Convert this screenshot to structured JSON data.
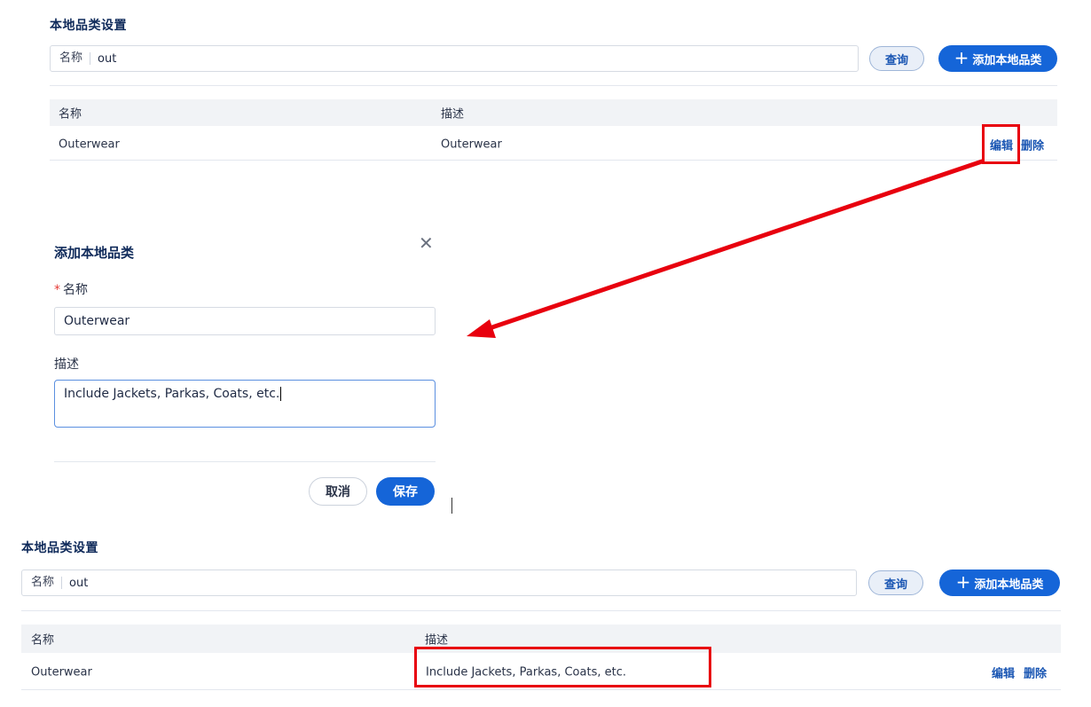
{
  "before": {
    "title": "本地品类设置",
    "search": {
      "label": "名称",
      "value": "out"
    },
    "query_label": "查询",
    "add_label": "添加本地品类",
    "table": {
      "headers": [
        "名称",
        "描述"
      ],
      "rows": [
        {
          "name": "Outerwear",
          "description": "Outerwear",
          "edit": "编辑",
          "delete": "删除"
        }
      ]
    }
  },
  "modal": {
    "title": "添加本地品类",
    "name_label": "名称",
    "name_value": "Outerwear",
    "desc_label": "描述",
    "desc_value": "Include Jackets, Parkas, Coats, etc.",
    "cancel_label": "取消",
    "save_label": "保存"
  },
  "after": {
    "title": "本地品类设置",
    "search": {
      "label": "名称",
      "value": "out"
    },
    "query_label": "查询",
    "add_label": "添加本地品类",
    "table": {
      "headers": [
        "名称",
        "描述"
      ],
      "rows": [
        {
          "name": "Outerwear",
          "description": "Include Jackets, Parkas, Coats, etc.",
          "edit": "编辑",
          "delete": "删除"
        }
      ]
    }
  },
  "colors": {
    "accent": "#1565d8",
    "highlight": "#e8000e",
    "title": "#0f2a5a"
  },
  "icons": {
    "add": "plus-icon",
    "close": "close-icon",
    "arrow": "red-arrow"
  }
}
